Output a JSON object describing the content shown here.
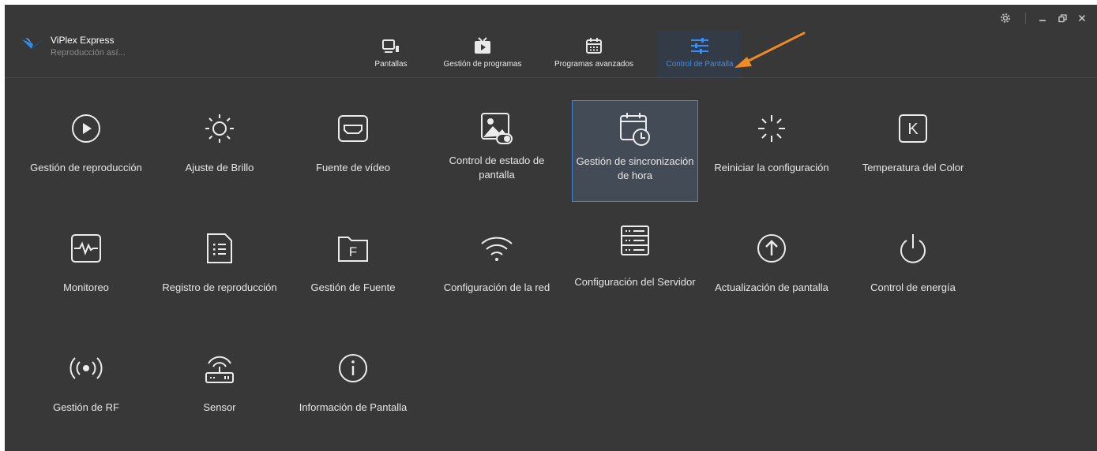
{
  "app": {
    "name": "ViPlex Express",
    "subtitle": "Reproducción así..."
  },
  "window_controls": [
    "settings-icon",
    "minimize-icon",
    "restore-icon",
    "close-icon"
  ],
  "nav": {
    "tabs": [
      {
        "label": "Pantallas",
        "icon": "screens-icon"
      },
      {
        "label": "Gestión de programas",
        "icon": "tv-play-icon"
      },
      {
        "label": "Programas avanzados",
        "icon": "calendar-icon"
      },
      {
        "label": "Control de Pantalla",
        "icon": "sliders-icon",
        "active": true
      }
    ]
  },
  "tiles": [
    {
      "label": "Gestión de reproducción",
      "icon": "play-circle-icon"
    },
    {
      "label": "Ajuste de Brillo",
      "icon": "sun-icon"
    },
    {
      "label": "Fuente de vídeo",
      "icon": "hdmi-icon"
    },
    {
      "label": "Control de estado de pantalla",
      "icon": "screen-status-icon"
    },
    {
      "label": "Gestión de sincronización de hora",
      "icon": "calendar-clock-icon",
      "selected": true
    },
    {
      "label": "Reiniciar la configuración",
      "icon": "loading-icon"
    },
    {
      "label": "Temperatura del Color",
      "icon": "kelvin-icon"
    },
    {
      "label": "Monitoreo",
      "icon": "monitor-pulse-icon"
    },
    {
      "label": "Registro de reproducción",
      "icon": "log-document-icon"
    },
    {
      "label": "Gestión de Fuente",
      "icon": "font-folder-icon"
    },
    {
      "label": "Configuración de la red",
      "icon": "wifi-icon"
    },
    {
      "label": "Configuración del Servidor",
      "icon": "server-icon"
    },
    {
      "label": "Actualización de pantalla",
      "icon": "upgrade-arrow-icon"
    },
    {
      "label": "Control de energía",
      "icon": "power-icon"
    },
    {
      "label": "Gestión de RF",
      "icon": "rf-signal-icon"
    },
    {
      "label": "Sensor",
      "icon": "sensor-router-icon"
    },
    {
      "label": "Información de Pantalla",
      "icon": "info-icon"
    }
  ],
  "colors": {
    "background": "#383838",
    "accent": "#3a8ef2",
    "selected_border": "#3d86d9",
    "annotation_arrow": "#f08a24"
  }
}
